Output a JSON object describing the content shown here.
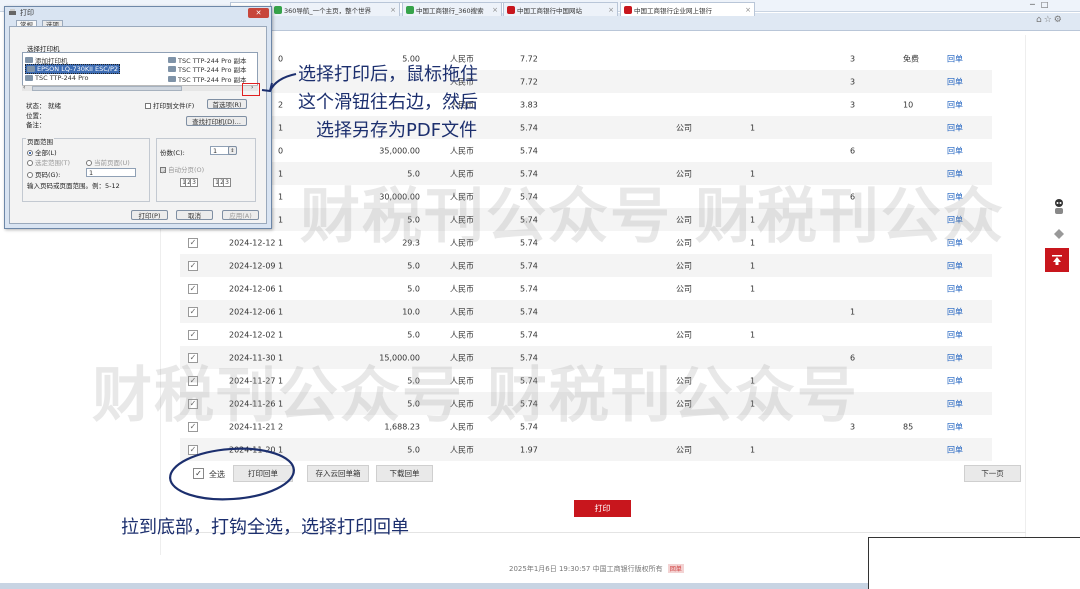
{
  "browser": {
    "search_icons": "⌕ ▾ ↻",
    "tabs": [
      {
        "label": "360导航_一个主页，整个世界",
        "favicon_color": "#36a34a"
      },
      {
        "label": "中国工商银行_360搜索",
        "favicon_color": "#36a34a"
      },
      {
        "label": "中国工商银行中国网站",
        "favicon_color": "#c8161d"
      },
      {
        "label": "中国工商银行企业网上银行",
        "favicon_color": "#c8161d"
      }
    ],
    "chrome_icons": "⌂☆⚙"
  },
  "print_dialog": {
    "title": "打印",
    "tabs": [
      "常规",
      "选项"
    ],
    "select_printer_label": "选择打印机",
    "printers_left": [
      "添加打印机",
      "EPSON LQ-730KII ESC/P2",
      "TSC TTP-244 Pro"
    ],
    "printers_right": [
      "TSC TTP-244 Pro 副本",
      "TSC TTP-244 Pro 副本",
      "TSC TTP-244 Pro 副本"
    ],
    "status_label": "状态：",
    "status_value": "就绪",
    "location_label": "位置：",
    "comment_label": "备注：",
    "print_to_file_label": "打印到文件(F)",
    "preferences_button": "首选项(R)",
    "find_printer_button": "查找打印机(D)...",
    "page_range_label": "页面范围",
    "range_all": "全部(L)",
    "range_selection": "选定范围(T)",
    "range_current": "当前页面(U)",
    "range_pages": "页码(G):",
    "pages_value": "1",
    "pages_hint": "输入页码或页面范围。例：5-12",
    "copies_label": "份数(C):",
    "copies_value": "1",
    "collate_label": "自动分页(O)",
    "print_button": "打印(P)",
    "cancel_button": "取消",
    "apply_button": "应用(A)"
  },
  "annotations": {
    "top_line1": "选择打印后，鼠标拖住",
    "top_line2": "这个滑钮往右边，然后",
    "top_line3": "选择另存为PDF文件",
    "bottom": "拉到底部，打钩全选，选择打印回单"
  },
  "watermark": {
    "line1": "财税刊公众号 财税刊公众",
    "line2": "财税刊公众号 财税刊公众号"
  },
  "transactions": [
    {
      "date": "",
      "seq": "0",
      "amount": "5.00",
      "currency": "人民币",
      "balance": "7.72",
      "entity": "",
      "n1": "",
      "n2": "3",
      "fee": "免费",
      "link": "回单",
      "checked": false
    },
    {
      "date": "",
      "seq": "",
      "amount": "",
      "currency": "人民币",
      "balance": "7.72",
      "entity": "",
      "n1": "",
      "n2": "3",
      "fee": "",
      "link": "回单",
      "checked": false
    },
    {
      "date": "",
      "seq": "2",
      "amount": "",
      "currency": "人民币",
      "balance": "3.83",
      "entity": "",
      "n1": "",
      "n2": "3",
      "fee": "10",
      "link": "回单",
      "checked": false
    },
    {
      "date": "",
      "seq": "1",
      "amount": "",
      "currency": "",
      "balance": "5.74",
      "entity": "公司",
      "n1": "1",
      "n2": "",
      "fee": "",
      "link": "回单",
      "checked": false
    },
    {
      "date": "",
      "seq": "0",
      "amount": "35,000.00",
      "currency": "人民币",
      "balance": "5.74",
      "entity": "",
      "n1": "",
      "n2": "6",
      "fee": "",
      "link": "回单",
      "checked": false
    },
    {
      "date": "",
      "seq": "1",
      "amount": "5.0",
      "currency": "人民币",
      "balance": "5.74",
      "entity": "公司",
      "n1": "1",
      "n2": "",
      "fee": "",
      "link": "回单",
      "checked": false
    },
    {
      "date": "",
      "seq": "1",
      "amount": "30,000.00",
      "currency": "人民币",
      "balance": "5.74",
      "entity": "",
      "n1": "",
      "n2": "6",
      "fee": "",
      "link": "回单",
      "checked": false
    },
    {
      "date": "",
      "seq": "1",
      "amount": "5.0",
      "currency": "人民币",
      "balance": "5.74",
      "entity": "公司",
      "n1": "1",
      "n2": "",
      "fee": "",
      "link": "回单",
      "checked": false
    },
    {
      "date": "2024-12-12",
      "seq": "1",
      "amount": "29.3",
      "currency": "人民币",
      "balance": "5.74",
      "entity": "公司",
      "n1": "1",
      "n2": "",
      "fee": "",
      "link": "回单",
      "checked": true
    },
    {
      "date": "2024-12-09",
      "seq": "1",
      "amount": "5.0",
      "currency": "人民币",
      "balance": "5.74",
      "entity": "公司",
      "n1": "1",
      "n2": "",
      "fee": "",
      "link": "回单",
      "checked": true
    },
    {
      "date": "2024-12-06",
      "seq": "1",
      "amount": "5.0",
      "currency": "人民币",
      "balance": "5.74",
      "entity": "公司",
      "n1": "1",
      "n2": "",
      "fee": "",
      "link": "回单",
      "checked": true
    },
    {
      "date": "2024-12-06",
      "seq": "1",
      "amount": "10.0",
      "currency": "人民币",
      "balance": "5.74",
      "entity": "",
      "n1": "",
      "n2": "1",
      "fee": "",
      "link": "回单",
      "checked": true
    },
    {
      "date": "2024-12-02",
      "seq": "1",
      "amount": "5.0",
      "currency": "人民币",
      "balance": "5.74",
      "entity": "公司",
      "n1": "1",
      "n2": "",
      "fee": "",
      "link": "回单",
      "checked": true
    },
    {
      "date": "2024-11-30",
      "seq": "1",
      "amount": "15,000.00",
      "currency": "人民币",
      "balance": "5.74",
      "entity": "",
      "n1": "",
      "n2": "6",
      "fee": "",
      "link": "回单",
      "checked": true
    },
    {
      "date": "2024-11-27",
      "seq": "1",
      "amount": "5.0",
      "currency": "人民币",
      "balance": "5.74",
      "entity": "公司",
      "n1": "1",
      "n2": "",
      "fee": "",
      "link": "回单",
      "checked": true
    },
    {
      "date": "2024-11-26",
      "seq": "1",
      "amount": "5.0",
      "currency": "人民币",
      "balance": "5.74",
      "entity": "公司",
      "n1": "1",
      "n2": "",
      "fee": "",
      "link": "回单",
      "checked": true
    },
    {
      "date": "2024-11-21",
      "seq": "2",
      "amount": "1,688.23",
      "currency": "人民币",
      "balance": "5.74",
      "entity": "",
      "n1": "",
      "n2": "3",
      "fee": "85",
      "link": "回单",
      "checked": true
    },
    {
      "date": "2024-11-20",
      "seq": "1",
      "amount": "5.0",
      "currency": "人民币",
      "balance": "1.97",
      "entity": "公司",
      "n1": "1",
      "n2": "",
      "fee": "",
      "link": "回单",
      "checked": true
    }
  ],
  "actions": {
    "select_all_label": "全选",
    "print_receipt": "打印回单",
    "save_cloud": "存入云回单箱",
    "download_receipt": "下载回单",
    "next_page": "下一页",
    "print": "打印"
  },
  "footer": {
    "text": "2025年1月6日 19:30:57    中国工商银行版权所有",
    "badge": "回单"
  },
  "colors": {
    "brand_red": "#c8161d",
    "link_blue": "#1b5fbf",
    "annotation_blue": "#1c2f6e"
  }
}
